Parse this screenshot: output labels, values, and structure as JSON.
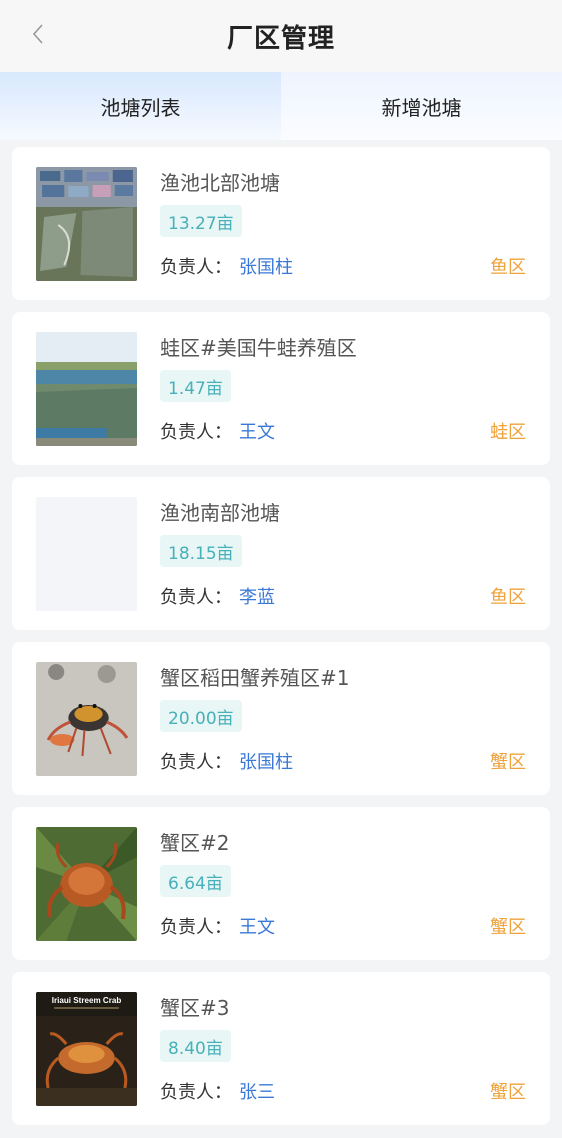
{
  "header": {
    "title": "厂区管理",
    "back_icon": "chevron-left-icon"
  },
  "tabs": [
    {
      "label": "池塘列表",
      "active": true
    },
    {
      "label": "新增池塘",
      "active": false
    }
  ],
  "ponds": [
    {
      "name": "渔池北部池塘",
      "area": "13.27亩",
      "owner_label": "负责人：",
      "owner": "张国柱",
      "type": "鱼区",
      "image": "fish-pond-aerial-photo"
    },
    {
      "name": "蛙区#美国牛蛙养殖区",
      "area": "1.47亩",
      "owner_label": "负责人：",
      "owner": "王文",
      "type": "蛙区",
      "image": "frog-pond-photo"
    },
    {
      "name": "渔池南部池塘",
      "area": "18.15亩",
      "owner_label": "负责人：",
      "owner": "李蓝",
      "type": "鱼区",
      "image": "empty-placeholder"
    },
    {
      "name": "蟹区稻田蟹养殖区#1",
      "area": "20.00亩",
      "owner_label": "负责人：",
      "owner": "张国柱",
      "type": "蟹区",
      "image": "crab-on-sand-photo"
    },
    {
      "name": "蟹区#2",
      "area": "6.64亩",
      "owner_label": "负责人：",
      "owner": "王文",
      "type": "蟹区",
      "image": "crab-on-leaf-photo"
    },
    {
      "name": "蟹区#3",
      "area": "8.40亩",
      "owner_label": "负责人：",
      "owner": "张三",
      "type": "蟹区",
      "image": "crab-poster",
      "image_text": "Iriaui Streem Crab"
    }
  ],
  "colors": {
    "owner_name": "#3a78d8",
    "type_tag": "#f0a23a",
    "area_text": "#47b0b8",
    "area_bg": "#e8f6f6"
  }
}
